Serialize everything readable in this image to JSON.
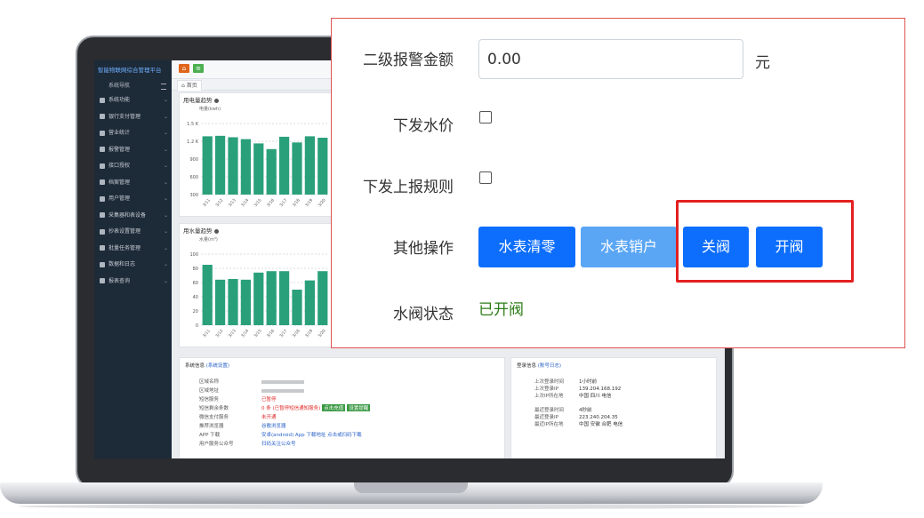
{
  "app": {
    "title": "智能物联网综合管理平台",
    "nav_header": "系统导航",
    "nav": [
      {
        "label": "系统功能"
      },
      {
        "label": "银行支付管理"
      },
      {
        "label": "营业统计"
      },
      {
        "label": "报警管理"
      },
      {
        "label": "接口授权"
      },
      {
        "label": "档案管理"
      },
      {
        "label": "用户管理"
      },
      {
        "label": "采集器和表设备"
      },
      {
        "label": "抄表设置管理"
      },
      {
        "label": "批量任务管理"
      },
      {
        "label": "数据和日志"
      },
      {
        "label": "报表查询"
      }
    ],
    "home_tab": "首页"
  },
  "electric_chart": {
    "title": "用电量趋势",
    "unit": "电量(kwh)",
    "yticks": [
      "1.5 K",
      "1.2 K",
      "900",
      "600",
      "300"
    ]
  },
  "water_chart": {
    "title": "用水量趋势",
    "unit": "水量(m³)",
    "yticks": [
      "100",
      "80",
      "60",
      "40",
      "20",
      "0"
    ]
  },
  "chart_data": [
    {
      "type": "bar",
      "title": "用电量趋势",
      "ylabel": "电量(kwh)",
      "categories": [
        "3/11",
        "3/12",
        "3/13",
        "3/14",
        "3/15",
        "3/16",
        "3/17",
        "3/18",
        "3/19",
        "3/20"
      ],
      "values": [
        1230,
        1240,
        1210,
        1170,
        1080,
        960,
        1220,
        1100,
        1230,
        1200
      ],
      "ylim": [
        0,
        1500
      ],
      "color": "#2aa07a"
    },
    {
      "type": "bar",
      "title": "用水量趋势",
      "ylabel": "水量(m³)",
      "categories": [
        "3/11",
        "3/12",
        "3/13",
        "3/14",
        "3/15",
        "3/16",
        "3/17",
        "3/18",
        "3/19",
        "3/20"
      ],
      "values": [
        85,
        64,
        65,
        64,
        74,
        76,
        76,
        50,
        63,
        76
      ],
      "ylim": [
        0,
        100
      ],
      "color": "#2aa07a"
    }
  ],
  "system_info": {
    "title": "系统信息",
    "link": "(系统设置)",
    "rows": [
      {
        "label": "区域名称",
        "value": ""
      },
      {
        "label": "区域地址",
        "value": ""
      },
      {
        "label": "短信服务",
        "value": "已暂停"
      },
      {
        "label": "短信剩余条数",
        "value": "0 条 (已暂停短信通知服务)",
        "btn1": "点击充值",
        "btn2": "设置提醒"
      },
      {
        "label": "微信支付服务",
        "value": "未开通"
      },
      {
        "label": "推荐浏览器",
        "value": "谷歌浏览器"
      },
      {
        "label": "APP 下载",
        "value": "安卓(android) App 下载地址 点击或扫码下载"
      },
      {
        "label": "用户服务公众号",
        "value": "扫码关注公众号"
      }
    ]
  },
  "login_info": {
    "title": "登录信息",
    "link": "(账号日志)",
    "rows": [
      {
        "label": "上次登录时间",
        "value": "1小时前"
      },
      {
        "label": "上次登录IP",
        "value": "139.204.168.192"
      },
      {
        "label": "上次IP所在地",
        "value": "中国 四川 电信"
      },
      {
        "label": "最近登录时间",
        "value": "4秒前"
      },
      {
        "label": "最近登录IP",
        "value": "223.240.204.35"
      },
      {
        "label": "最近IP所在地",
        "value": "中国 安徽 合肥 电信"
      }
    ]
  },
  "popup": {
    "alarm2_label": "二级报警金额",
    "alarm2_value": "0.00",
    "unit": "元",
    "send_price_label": "下发水价",
    "send_rule_label": "下发上报规则",
    "other_ops_label": "其他操作",
    "btn_clear": "水表清零",
    "btn_cancel": "水表销户",
    "btn_close": "关阀",
    "btn_open": "开阀",
    "valve_label": "水阀状态",
    "valve_status": "已开阀",
    "colors": {
      "primary": "#0d6efd",
      "disabled": "#5aa6f5",
      "status": "#2e7d18",
      "highlight": "#e32020"
    }
  }
}
